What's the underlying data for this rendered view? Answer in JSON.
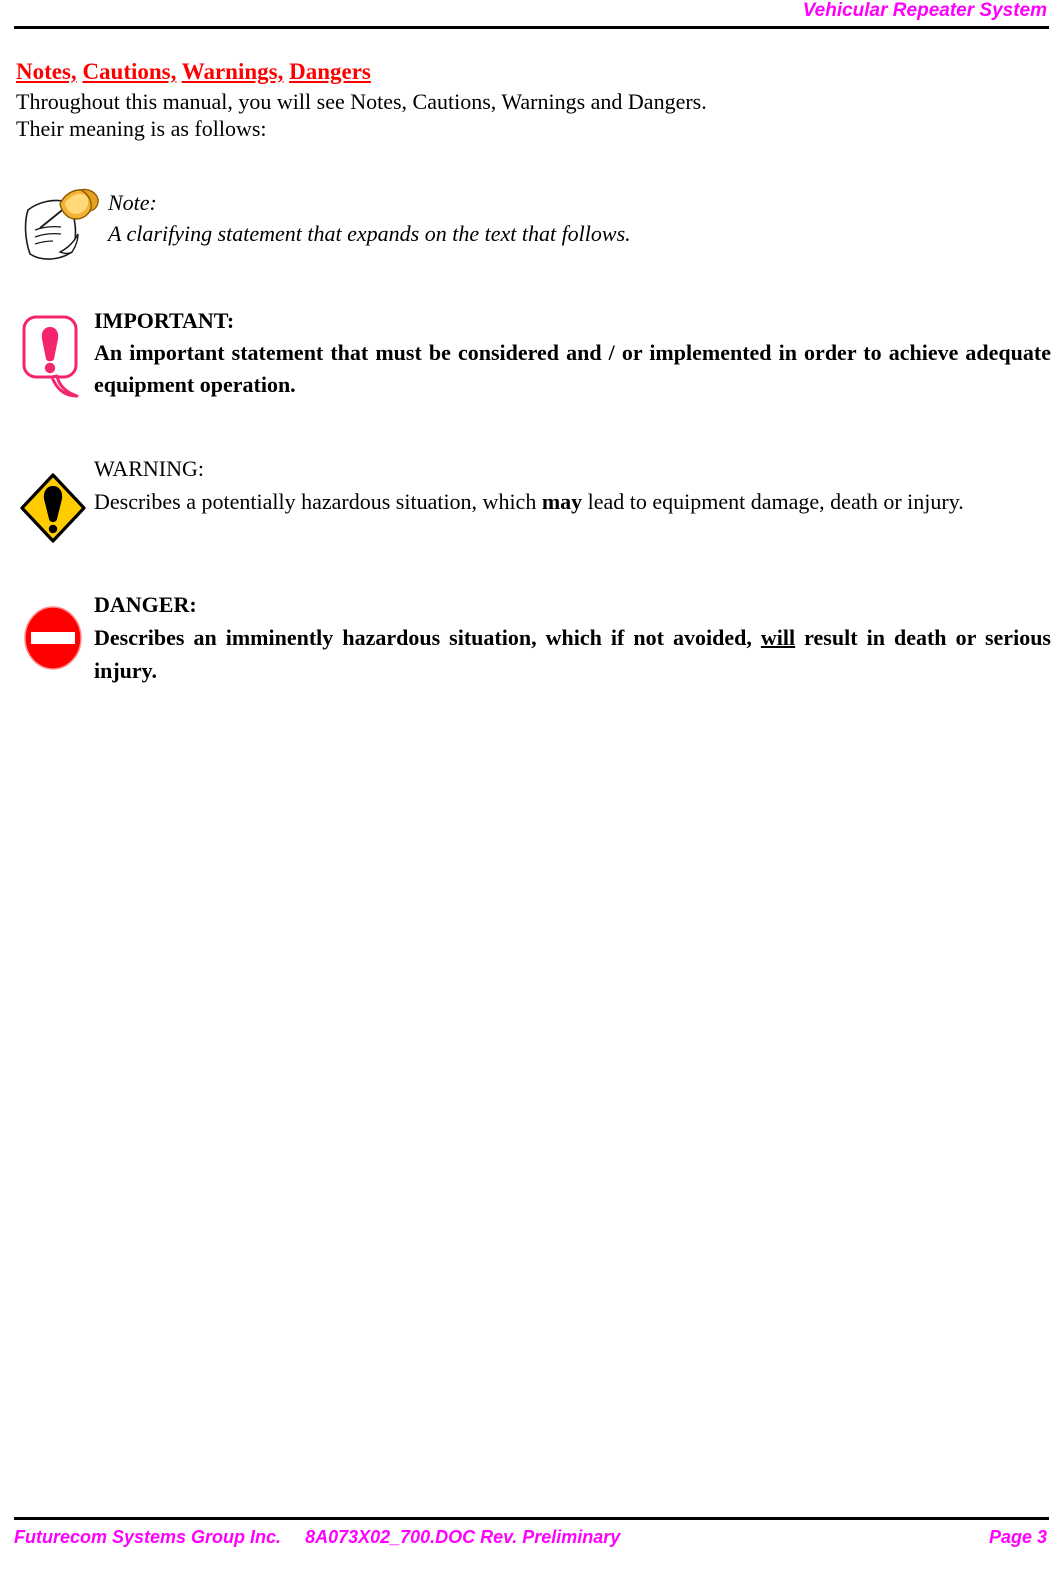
{
  "header": {
    "title": "Vehicular Repeater System"
  },
  "body": {
    "heading_words": [
      "Notes,",
      "Cautions,",
      "Warnings,",
      "Dangers"
    ],
    "intro_line_1": "Throughout this manual, you will see Notes, Cautions, Warnings and Dangers.",
    "intro_line_2": "Their meaning is as follows:"
  },
  "note": {
    "icon": "pushpin-note-icon",
    "title": "Note:",
    "text": "A clarifying statement that expands on the text that follows."
  },
  "important": {
    "icon": "exclamation-speech-bubble-icon",
    "icon_color": "#F4246E",
    "title": "IMPORTANT:",
    "text": "An important statement that must be considered and / or implemented in order to achieve adequate equipment operation."
  },
  "warning": {
    "icon": "yellow-diamond-exclamation-icon",
    "icon_color": "#FFCC00",
    "title": "WARNING:",
    "text_part_1": "Describes a potentially hazardous situation, which ",
    "emphasis": "may",
    "text_part_2": " lead to equipment damage, death or injury."
  },
  "danger": {
    "icon": "no-entry-sign-icon",
    "icon_color": "#FF0000",
    "title": "DANGER:",
    "text_part_1": "Describes an imminently hazardous situation, which if not avoided, ",
    "emphasis": "will",
    "text_part_2": " result in death or serious injury."
  },
  "footer": {
    "company": "Futurecom Systems Group Inc.",
    "document": "8A073X02_700.DOC Rev. Preliminary",
    "page": "Page 3"
  },
  "colors": {
    "header_footer_text": "#FF00FF",
    "heading_red": "#FF0000",
    "rule_black": "#000000"
  }
}
